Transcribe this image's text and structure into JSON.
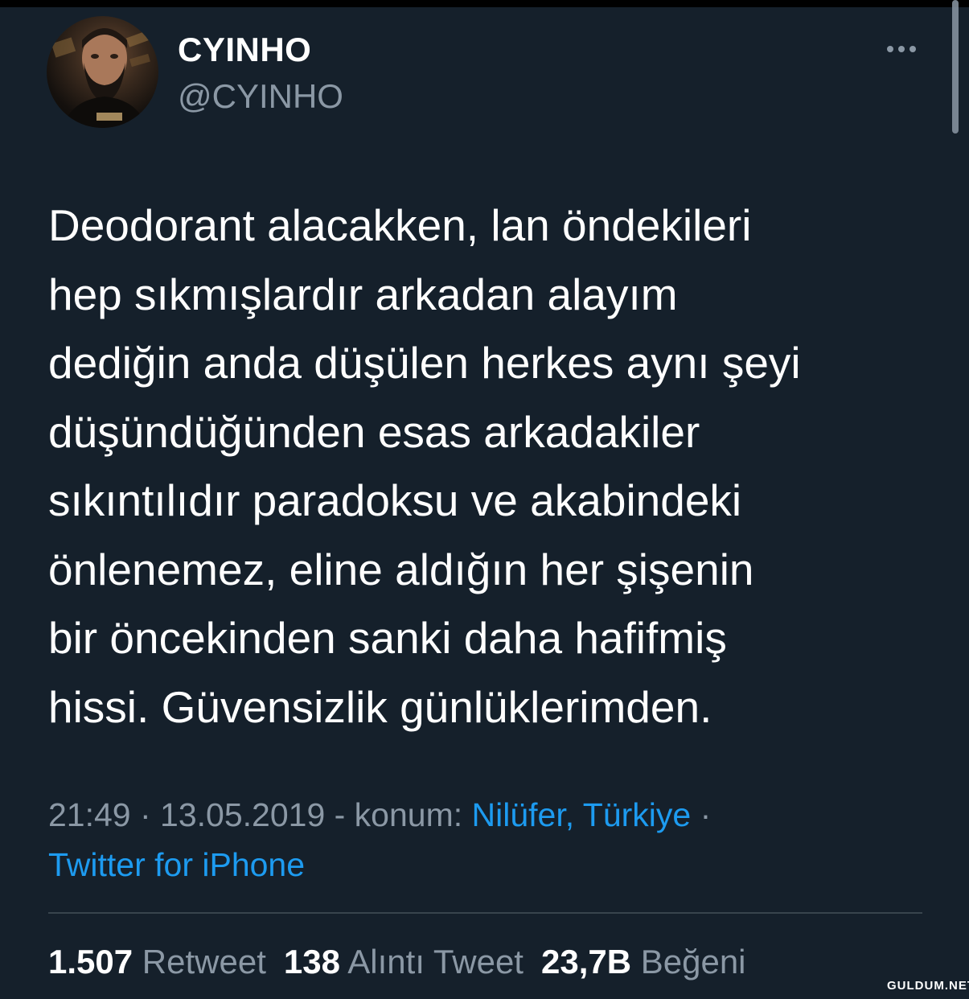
{
  "user": {
    "display_name": "CYINHO",
    "handle": "@CYINHO"
  },
  "more_icon": "more-horizontal-icon",
  "tweet": {
    "lines": [
      "Deodorant alacakken, lan öndekileri",
      "hep sıkmışlardır arkadan alayım",
      "dediğin anda düşülen herkes aynı şeyi",
      "düşündüğünden esas arkadakiler",
      "sıkıntılıdır paradoksu ve akabindeki",
      "önlenemez, eline aldığın her şişenin",
      "bir öncekinden sanki daha hafifmiş",
      "hissi. Güvensizlik günlüklerimden."
    ]
  },
  "meta": {
    "time": "21:49",
    "sep1": " · ",
    "date": "13.05.2019",
    "location_prefix": " - konum: ",
    "location": "Nilüfer, Türkiye",
    "sep2": " ·",
    "source": "Twitter for iPhone"
  },
  "stats": {
    "retweets": {
      "count": "1.507",
      "label": "Retweet"
    },
    "quotes": {
      "count": "138",
      "label": "Alıntı Tweet"
    },
    "likes": {
      "count": "23,7B",
      "label": "Beğeni"
    }
  },
  "watermark": "GULDUM.NET",
  "colors": {
    "background": "#15202b",
    "text": "#ffffff",
    "secondary_text": "#8b98a5",
    "link": "#1d9bf0",
    "divider": "#38444d"
  }
}
